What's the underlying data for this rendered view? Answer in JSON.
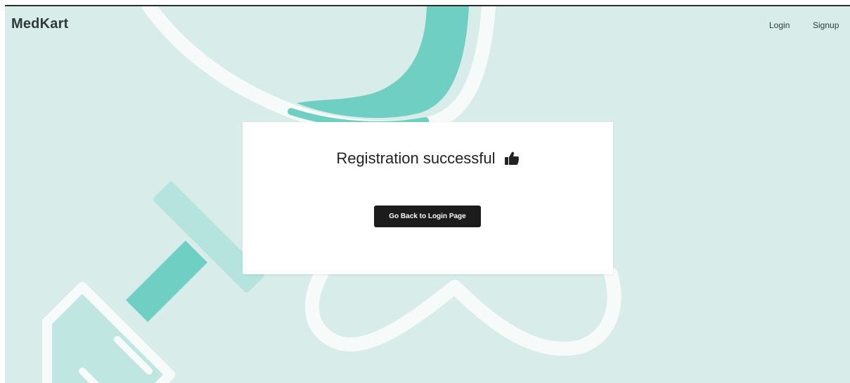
{
  "navbar": {
    "brand": "MedKart",
    "links": [
      {
        "label": "Login"
      },
      {
        "label": "Signup"
      }
    ]
  },
  "card": {
    "title": "Registration successful",
    "title_icon": "thumbs-up-icon",
    "button_label": "Go Back to Login Page"
  },
  "colors": {
    "background": "#d8ecea",
    "accent": "#6fcfc3",
    "accent_light": "#b5e3dd",
    "button": "#1c1c1c"
  }
}
